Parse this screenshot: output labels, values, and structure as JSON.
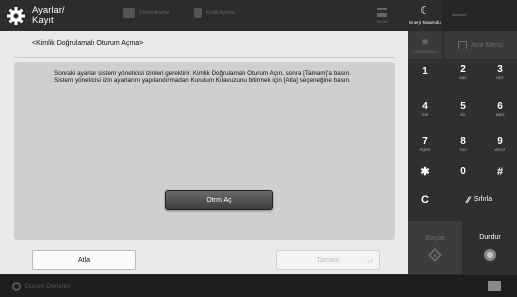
{
  "header": {
    "title_line1": "Ayarlar/",
    "title_line2": "Kayıt",
    "tool1_label": "Düzeli Ayarlar",
    "tool2_label": "Kesfli Ayarlar",
    "menu_label": "Menü",
    "energy_label": "Enerji Tasarrufu"
  },
  "screen": {
    "heading": "<Kimlik Doğrulamalı Oturum Açma>",
    "message_line1": "Sonraki ayarlar sistem yöneticisi izinleri gerektirir. Kimlik Doğrulamalı Oturum Açın, sonra [Tamam]'a basın.",
    "message_line2": "Sistem yöneticisi izin ayarlarını yapılandırmadan Kurulum Kılavuzunu bitirmek için [Atla] seçeneğine basın.",
    "login_button": "Otrm Aç",
    "skip_button": "Atla",
    "ok_button": "Tamam",
    "ok_enter_symbol": "⏎"
  },
  "status": {
    "text": "Durum Denetim"
  },
  "keypad": {
    "top_left_label": "Ayarlar/Kayıt",
    "top_right_label": "Ana Menü",
    "keys": [
      {
        "digit": "1",
        "sub": ""
      },
      {
        "digit": "2",
        "sub": "ABC"
      },
      {
        "digit": "3",
        "sub": "DEF"
      },
      {
        "digit": "4",
        "sub": "GHI"
      },
      {
        "digit": "5",
        "sub": "JKL"
      },
      {
        "digit": "6",
        "sub": "MNO"
      },
      {
        "digit": "7",
        "sub": "PQRS"
      },
      {
        "digit": "8",
        "sub": "TUV"
      },
      {
        "digit": "9",
        "sub": "WXYZ"
      },
      {
        "digit": "✱",
        "sub": ""
      },
      {
        "digit": "0",
        "sub": ""
      },
      {
        "digit": "#",
        "sub": ""
      }
    ],
    "clear_key": "C",
    "reset_label": "Sıfırla",
    "start_label": "Başlat",
    "stop_label": "Durdur"
  }
}
